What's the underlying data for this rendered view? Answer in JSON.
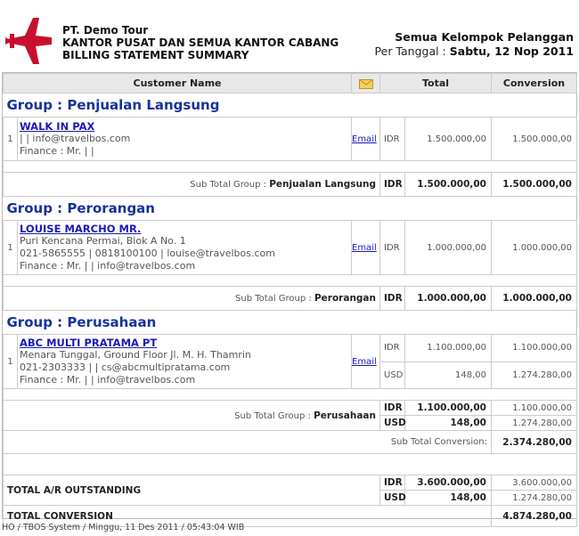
{
  "header": {
    "company_name": "PT. Demo Tour",
    "office_line": "KANTOR PUSAT DAN SEMUA KANTOR CABANG",
    "report_title": "BILLING STATEMENT SUMMARY",
    "customer_group_scope": "Semua Kelompok Pelanggan",
    "date_label": "Per Tanggal :",
    "date_value": "Sabtu, 12 Nop 2011"
  },
  "columns": {
    "customer_name": "Customer Name",
    "total": "Total",
    "conversion": "Conversion"
  },
  "groups": [
    {
      "title": "Group : Penjualan Langsung",
      "customer": {
        "index": "1",
        "name": "WALK IN PAX",
        "address": "| | info@travelbos.com",
        "phone": "",
        "finance": "Finance : Mr. | |",
        "email_link": "Email",
        "amounts": [
          {
            "currency": "IDR",
            "total": "1.500.000,00",
            "conversion": "1.500.000,00"
          }
        ]
      },
      "subtotal_label": "Sub Total Group :",
      "subtotal_group": "Penjualan Langsung",
      "subtotals": [
        {
          "currency": "IDR",
          "total": "1.500.000,00",
          "conversion": "1.500.000,00"
        }
      ]
    },
    {
      "title": "Group : Perorangan",
      "customer": {
        "index": "1",
        "name": "LOUISE MARCHO MR.",
        "address": "Puri Kencana Permai, Blok A No. 1",
        "phone": "021-5865555 | 0818100100 | louise@travelbos.com",
        "finance": "Finance : Mr. | | info@travelbos.com",
        "email_link": "Email",
        "amounts": [
          {
            "currency": "IDR",
            "total": "1.000.000,00",
            "conversion": "1.000.000,00"
          }
        ]
      },
      "subtotal_label": "Sub Total Group :",
      "subtotal_group": "Perorangan",
      "subtotals": [
        {
          "currency": "IDR",
          "total": "1.000.000,00",
          "conversion": "1.000.000,00"
        }
      ]
    },
    {
      "title": "Group : Perusahaan",
      "customer": {
        "index": "1",
        "name": "ABC MULTI PRATAMA PT",
        "address": "Menara Tunggal, Ground Floor Jl. M. H. Thamrin",
        "phone": "021-2303333 | | cs@abcmultipratama.com",
        "finance": "Finance : Mr. | | info@travelbos.com",
        "email_link": "Email",
        "amounts": [
          {
            "currency": "IDR",
            "total": "1.100.000,00",
            "conversion": "1.100.000,00"
          },
          {
            "currency": "USD",
            "total": "148,00",
            "conversion": "1.274.280,00"
          }
        ]
      },
      "subtotal_label": "Sub Total Group :",
      "subtotal_group": "Perusahaan",
      "subtotals": [
        {
          "currency": "IDR",
          "total": "1.100.000,00",
          "conversion": "1.100.000,00"
        },
        {
          "currency": "USD",
          "total": "148,00",
          "conversion": "1.274.280,00"
        }
      ],
      "subtotal_conversion_label": "Sub Total Conversion:",
      "subtotal_conversion_value": "2.374.280,00"
    }
  ],
  "totals": {
    "ar_label": "TOTAL A/R OUTSTANDING",
    "ar": [
      {
        "currency": "IDR",
        "total": "3.600.000,00",
        "conversion": "3.600.000,00"
      },
      {
        "currency": "USD",
        "total": "148,00",
        "conversion": "1.274.280,00"
      }
    ],
    "conversion_label": "TOTAL CONVERSION",
    "conversion_value": "4.874.280,00"
  },
  "footer": {
    "text": "HO / TBOS System / Minggu, 11 Des 2011 / 05:43:04 WIB"
  },
  "colors": {
    "logo": "#c8102e",
    "group_title": "#16329a",
    "link": "#1a1ab8",
    "header_bg": "#e8e8e8"
  },
  "icons": {
    "logo": "airplane-logo",
    "email_header": "envelope-icon"
  }
}
